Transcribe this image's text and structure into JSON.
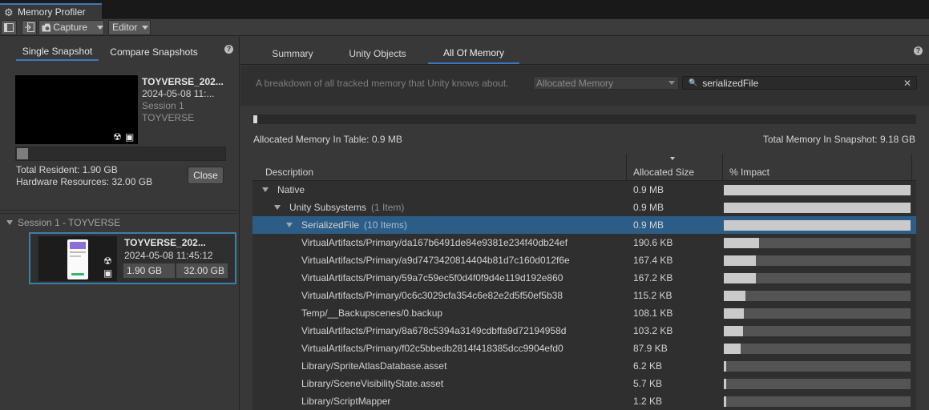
{
  "window": {
    "tab_title": "Memory Profiler"
  },
  "toolbar": {
    "capture_label": "Capture",
    "editor_label": "Editor"
  },
  "left": {
    "tabs": [
      "Single Snapshot",
      "Compare Snapshots"
    ],
    "snapshot": {
      "name": "TOYVERSE_202...",
      "date": "2024-05-08 11:...",
      "session": "Session 1",
      "project": "TOYVERSE"
    },
    "total_resident": "Total Resident: 1.90 GB",
    "hardware_resources": "Hardware Resources: 32.00 GB",
    "close_label": "Close",
    "session_header": "Session 1 - TOYVERSE",
    "session_item": {
      "name": "TOYVERSE_202...",
      "date": "2024-05-08 11:45:12",
      "resident": "1.90 GB",
      "hardware": "32.00 GB"
    }
  },
  "right": {
    "tabs": [
      "Summary",
      "Unity Objects",
      "All Of Memory"
    ],
    "active_tab": "All Of Memory",
    "description": "A breakdown of all tracked memory that Unity knows about.",
    "memory_mode": "Allocated Memory",
    "search_value": "serializedFile",
    "progress_fraction": 0.006,
    "allocated_in_table": "Allocated Memory In Table: 0.9 MB",
    "total_in_snapshot": "Total Memory In Snapshot: 9.18 GB",
    "columns": {
      "description": "Description",
      "size": "Allocated Size",
      "impact": "% Impact"
    },
    "rows": [
      {
        "name": "Native",
        "count": "",
        "size": "0.9 MB",
        "indent": 0,
        "expanded": true,
        "impact": 1.0,
        "selected": false
      },
      {
        "name": "Unity Subsystems",
        "count": "(1 Item)",
        "size": "0.9 MB",
        "indent": 1,
        "expanded": true,
        "impact": 1.0,
        "selected": false
      },
      {
        "name": "SerializedFile",
        "count": "(10 Items)",
        "size": "0.9 MB",
        "indent": 2,
        "expanded": true,
        "impact": 1.0,
        "selected": true
      },
      {
        "name": "VirtualArtifacts/Primary/da167b6491de84e9381e234f40db24ef",
        "count": "",
        "size": "190.6 KB",
        "indent": 3,
        "expanded": false,
        "impact": 0.19,
        "selected": false
      },
      {
        "name": "VirtualArtifacts/Primary/a9d7473420814404b81d7c160d012f6e",
        "count": "",
        "size": "167.4 KB",
        "indent": 3,
        "expanded": false,
        "impact": 0.17,
        "selected": false
      },
      {
        "name": "VirtualArtifacts/Primary/59a7c59ec5f0d4f0f9d4e119d192e860",
        "count": "",
        "size": "167.2 KB",
        "indent": 3,
        "expanded": false,
        "impact": 0.17,
        "selected": false
      },
      {
        "name": "VirtualArtifacts/Primary/0c6c3029cfa354c6e82e2d5f50ef5b38",
        "count": "",
        "size": "115.2 KB",
        "indent": 3,
        "expanded": false,
        "impact": 0.115,
        "selected": false
      },
      {
        "name": "Temp/__Backupscenes/0.backup",
        "count": "",
        "size": "108.1 KB",
        "indent": 3,
        "expanded": false,
        "impact": 0.108,
        "selected": false
      },
      {
        "name": "VirtualArtifacts/Primary/8a678c5394a3149cdbffa9d72194958d",
        "count": "",
        "size": "103.2 KB",
        "indent": 3,
        "expanded": false,
        "impact": 0.103,
        "selected": false
      },
      {
        "name": "VirtualArtifacts/Primary/f02c5bbedb2814f418385dcc9904efd0",
        "count": "",
        "size": "87.9 KB",
        "indent": 3,
        "expanded": false,
        "impact": 0.088,
        "selected": false
      },
      {
        "name": "Library/SpriteAtlasDatabase.asset",
        "count": "",
        "size": "6.2 KB",
        "indent": 3,
        "expanded": false,
        "impact": 0.015,
        "selected": false
      },
      {
        "name": "Library/SceneVisibilityState.asset",
        "count": "",
        "size": "5.7 KB",
        "indent": 3,
        "expanded": false,
        "impact": 0.014,
        "selected": false
      },
      {
        "name": "Library/ScriptMapper",
        "count": "",
        "size": "1.2 KB",
        "indent": 3,
        "expanded": false,
        "impact": 0.012,
        "selected": false
      }
    ]
  },
  "colors": {
    "accent": "#3a79bb",
    "selected_row": "#2c5d87",
    "bar_fill": "#cacaca",
    "bar_bg": "#545454"
  }
}
